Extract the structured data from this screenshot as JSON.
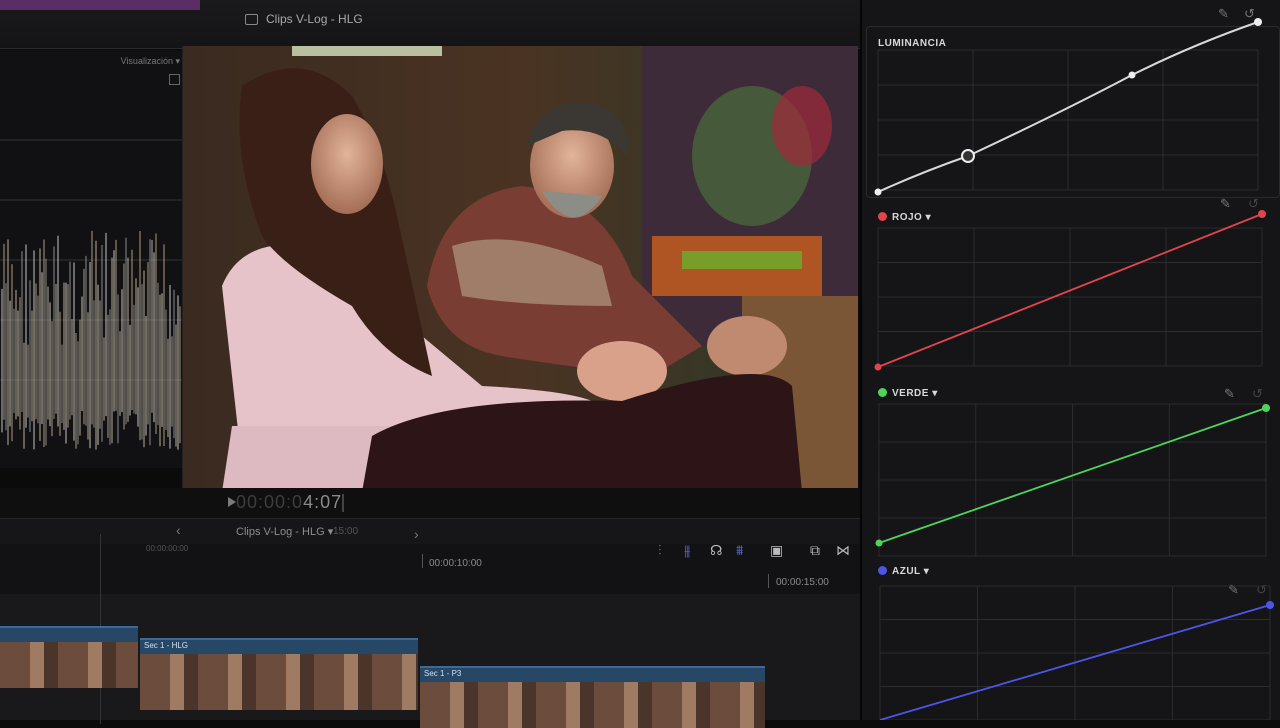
{
  "window": {
    "title": "Clips V-Log - HLG"
  },
  "scopes": {
    "label": "Visualización"
  },
  "viewer": {
    "timecode": "4:07",
    "timecode_prefix": "00:00:0"
  },
  "timeline": {
    "project_name": "Clips V-Log - HLG",
    "duration": "15:00",
    "ruler": {
      "start_label": "00:00:00:00",
      "mark_10": "00:00:10:00",
      "mark_15": "00:00:15:00"
    },
    "clips": [
      {
        "label": "Sec 1 - HLG"
      },
      {
        "label": "Sec 1 - P3"
      }
    ]
  },
  "tools": {
    "icons": [
      "audio-waveform-icon",
      "audio-skimming-icon",
      "headphones-icon",
      "solo-icon",
      "snapping-icon",
      "clip-appearance-icon",
      "transitions-icon"
    ]
  },
  "curves": {
    "luminance": {
      "label": "LUMINANCIA",
      "color": "#cfcfcf"
    },
    "red": {
      "label": "ROJO",
      "color": "#e0454c"
    },
    "green": {
      "label": "VERDE",
      "color": "#4fd35a"
    },
    "blue": {
      "label": "AZUL",
      "color": "#4d55e8"
    }
  },
  "colors": {
    "accent_blue": "#3b6a99",
    "purple_tab": "#5a2d64"
  }
}
